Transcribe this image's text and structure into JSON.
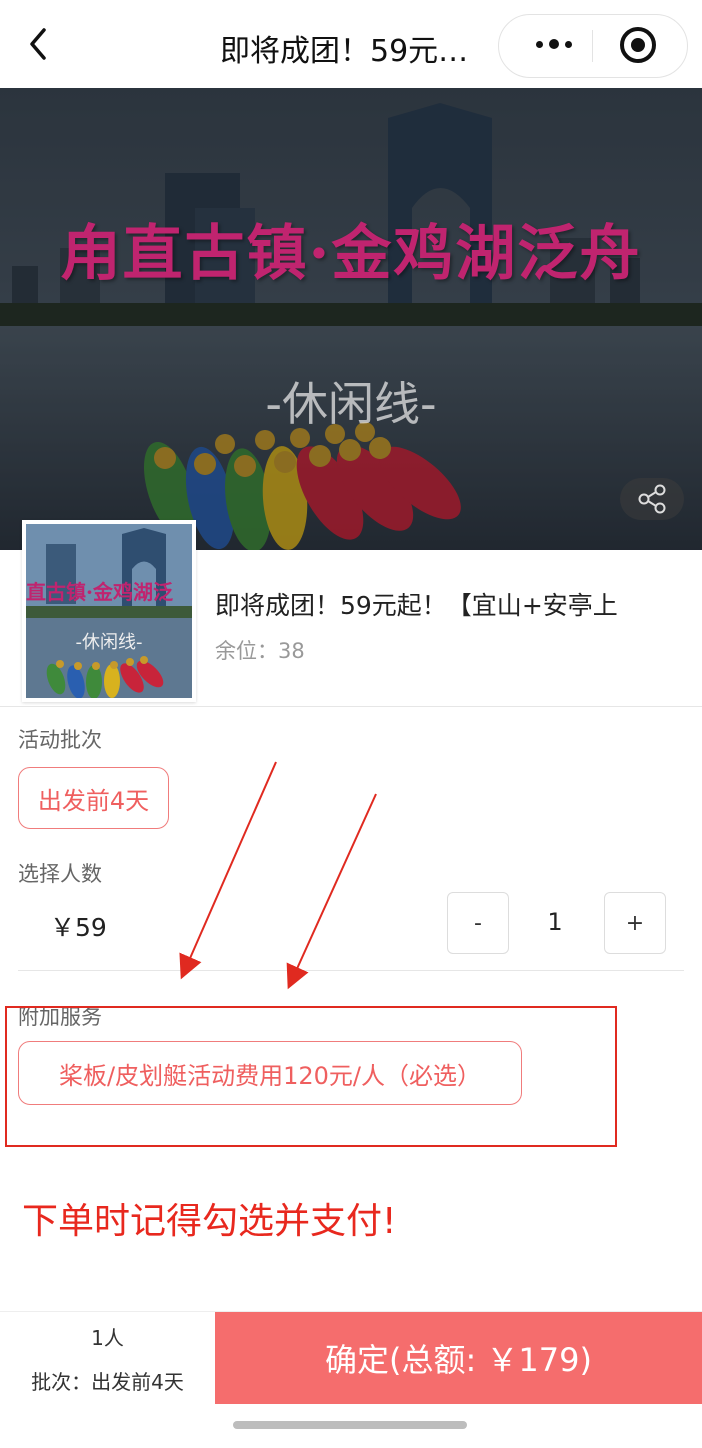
{
  "nav": {
    "title": "即将成团！59元…"
  },
  "banner": {
    "title": "甪直古镇·金鸡湖泛舟",
    "subtitle": "-休闲线-"
  },
  "product": {
    "thumb_title": "直古镇·金鸡湖泛",
    "thumb_subtitle": "-休闲线-",
    "name": "即将成团！59元起！【宜山+安亭上",
    "stock_label": "余位：",
    "stock_value": "38"
  },
  "batch": {
    "label": "活动批次",
    "options": [
      {
        "label": "出发前4天",
        "selected": true
      }
    ]
  },
  "people": {
    "label": "选择人数",
    "price": "￥59",
    "minus": "-",
    "quantity": "1",
    "plus": "+"
  },
  "addon": {
    "label": "附加服务",
    "option": "桨板/皮划艇活动费用120元/人（必选）"
  },
  "annotation": {
    "note": "下单时记得勾选并支付!"
  },
  "bottom_bar": {
    "count": "1人",
    "batch": "批次：出发前4天",
    "confirm": "确定(总额: ￥179)"
  },
  "colors": {
    "accent": "#f56d6d",
    "chip_text": "#ef5f5f",
    "annotation_red": "#e02a20",
    "banner_title": "#c0246f"
  }
}
